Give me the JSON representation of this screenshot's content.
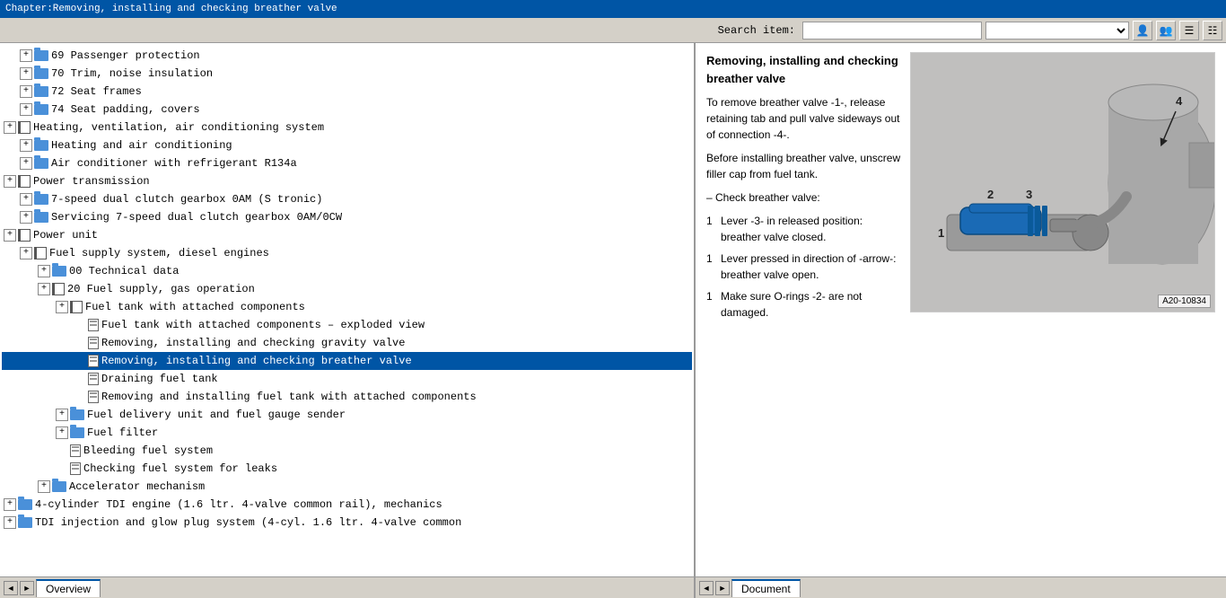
{
  "titleBar": {
    "text": "Chapter:Removing, installing and checking breather valve"
  },
  "toolbar": {
    "searchLabel": "Search item:",
    "searchPlaceholder": "",
    "searchValue": ""
  },
  "tree": {
    "items": [
      {
        "id": 1,
        "indent": 1,
        "type": "folder-expand",
        "text": "69  Passenger protection"
      },
      {
        "id": 2,
        "indent": 1,
        "type": "folder-expand",
        "text": "70  Trim, noise insulation"
      },
      {
        "id": 3,
        "indent": 1,
        "type": "folder-expand",
        "text": "72  Seat frames"
      },
      {
        "id": 4,
        "indent": 1,
        "type": "folder-expand",
        "text": "74  Seat padding, covers"
      },
      {
        "id": 5,
        "indent": 0,
        "type": "book-expand",
        "text": "Heating, ventilation, air conditioning system"
      },
      {
        "id": 6,
        "indent": 1,
        "type": "folder-expand",
        "text": "Heating and air conditioning"
      },
      {
        "id": 7,
        "indent": 1,
        "type": "folder-expand",
        "text": "Air conditioner with refrigerant R134a"
      },
      {
        "id": 8,
        "indent": 0,
        "type": "book-expand",
        "text": "Power transmission"
      },
      {
        "id": 9,
        "indent": 1,
        "type": "folder-expand",
        "text": "7-speed dual clutch gearbox 0AM (S tronic)"
      },
      {
        "id": 10,
        "indent": 1,
        "type": "folder-expand",
        "text": "Servicing 7-speed dual clutch gearbox 0AM/0CW"
      },
      {
        "id": 11,
        "indent": 0,
        "type": "book-expand",
        "text": "Power unit"
      },
      {
        "id": 12,
        "indent": 1,
        "type": "book-expand",
        "text": "Fuel supply system, diesel engines"
      },
      {
        "id": 13,
        "indent": 2,
        "type": "folder-expand",
        "text": "00  Technical data"
      },
      {
        "id": 14,
        "indent": 2,
        "type": "book-expand",
        "text": "20  Fuel supply, gas operation"
      },
      {
        "id": 15,
        "indent": 3,
        "type": "book-expand",
        "text": "Fuel tank with attached components"
      },
      {
        "id": 16,
        "indent": 4,
        "type": "doc",
        "text": "Fuel tank with attached components – exploded view"
      },
      {
        "id": 17,
        "indent": 4,
        "type": "doc",
        "text": "Removing, installing and checking gravity valve"
      },
      {
        "id": 18,
        "indent": 4,
        "type": "doc",
        "text": "Removing, installing and checking breather valve",
        "selected": true
      },
      {
        "id": 19,
        "indent": 4,
        "type": "doc",
        "text": "Draining fuel tank"
      },
      {
        "id": 20,
        "indent": 4,
        "type": "doc",
        "text": "Removing and installing fuel tank with attached components"
      },
      {
        "id": 21,
        "indent": 3,
        "type": "folder-expand",
        "text": "Fuel delivery unit and fuel gauge sender"
      },
      {
        "id": 22,
        "indent": 3,
        "type": "folder-expand",
        "text": "Fuel filter"
      },
      {
        "id": 23,
        "indent": 3,
        "type": "doc",
        "text": "Bleeding fuel system"
      },
      {
        "id": 24,
        "indent": 3,
        "type": "doc",
        "text": "Checking fuel system for leaks"
      },
      {
        "id": 25,
        "indent": 2,
        "type": "folder-expand",
        "text": "Accelerator mechanism"
      },
      {
        "id": 26,
        "indent": 0,
        "type": "folder-expand",
        "text": "4-cylinder TDI engine (1.6 ltr. 4-valve common rail), mechanics"
      },
      {
        "id": 27,
        "indent": 0,
        "type": "folder-expand",
        "text": "TDI injection and glow plug system (4-cyl. 1.6 ltr. 4-valve common"
      }
    ]
  },
  "document": {
    "title": "Removing, installing and checking breather valve",
    "paragraphs": [
      {
        "type": "text",
        "content": "To remove breather valve -1-, release retaining tab and pull valve sideways out of connection -4-."
      },
      {
        "type": "text",
        "content": "Before installing breather valve, unscrew filler cap from fuel tank."
      },
      {
        "type": "dash",
        "content": "Check breather valve:"
      },
      {
        "type": "numbered",
        "num": "1",
        "content": "Lever -3- in released position: breather valve closed."
      },
      {
        "type": "numbered",
        "num": "1",
        "content": "Lever pressed in direction of -arrow-: breather valve open."
      },
      {
        "type": "numbered",
        "num": "1",
        "content": "Make sure O-rings -2- are not damaged."
      }
    ],
    "imageRef": "A20-10834",
    "imageLabels": [
      "1",
      "2",
      "3",
      "4"
    ]
  },
  "bottomBar": {
    "left": {
      "tab": "Overview"
    },
    "right": {
      "tab": "Document"
    }
  },
  "icons": {
    "prevLeft": "◄",
    "prevRight": "►",
    "expand": "+",
    "collapse": "-",
    "userIcon": "👤",
    "listIcon": "☰"
  }
}
